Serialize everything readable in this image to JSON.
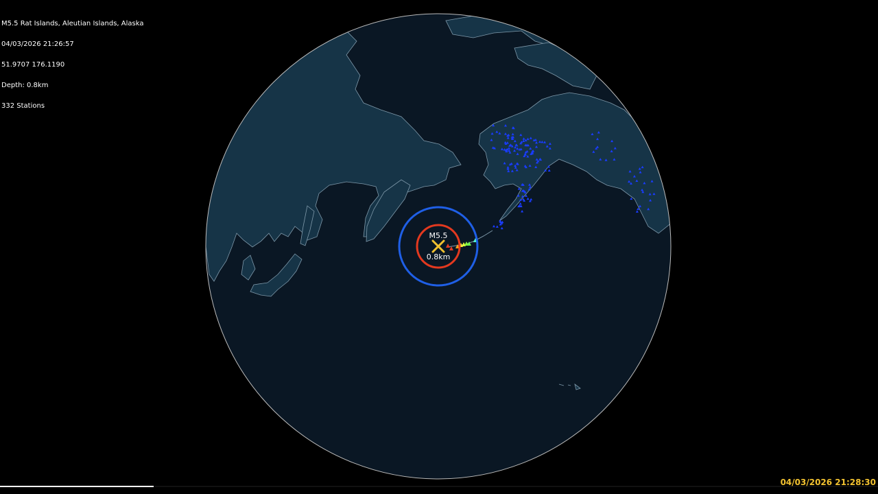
{
  "event": {
    "title": "M5.5 Rat Islands, Aleutian Islands, Alaska",
    "origin_time": "04/03/2026 21:26:57",
    "coordinates": "51.9707 176.1190",
    "depth_line": "Depth: 0.8km",
    "stations_line": "332 Stations"
  },
  "marker": {
    "magnitude_label": "M5.5",
    "depth_label": "0.8km",
    "epicenter_icon": "x-mark-icon"
  },
  "clock": {
    "current_time": "04/03/2026 21:28:30"
  },
  "playback": {
    "progress": 0.175
  },
  "colors": {
    "background": "#000000",
    "ocean": "#0a1724",
    "land": "#163447",
    "coastline": "#7f99aa",
    "globe_rim": "#bcbcbc",
    "inner_ring": "#e3391f",
    "outer_ring": "#1f5fe6",
    "epicenter": "#f2c230",
    "station_idle": "#1a3cff",
    "clock_text": "#f2c230"
  }
}
